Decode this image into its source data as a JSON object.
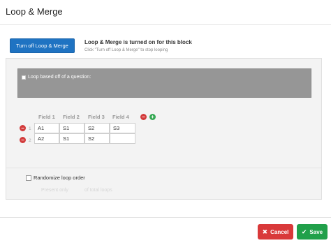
{
  "header": {
    "title": "Loop & Merge"
  },
  "loop": {
    "button_label": "Turn off Loop & Merge",
    "status_title": "Loop & Merge is turned on for this block",
    "status_subtitle": "Click \"Turn off Loop & Merge\" to stop looping",
    "question_checkbox_label": "Loop based off of a question:"
  },
  "table": {
    "headers": [
      "Field 1",
      "Field 2",
      "Field 3",
      "Field 4"
    ],
    "rows": [
      {
        "num": "1",
        "cells": [
          "A1",
          "S1",
          "S2",
          "S3"
        ]
      },
      {
        "num": "2",
        "cells": [
          "A2",
          "S1",
          "S2",
          ""
        ]
      }
    ]
  },
  "options": {
    "randomize_label": "Randomize loop order",
    "present_only": "Present only",
    "of_total_loops": "of total loops"
  },
  "footer": {
    "cancel_label": "Cancel",
    "save_label": "Save"
  },
  "colors": {
    "primary": "#1f73c2",
    "cancel": "#d9393a",
    "save": "#21a04a",
    "remove": "#d23a3a",
    "add": "#34a853"
  },
  "icons": {
    "remove": "minus-circle-icon",
    "add": "plus-circle-icon",
    "cancel": "x-icon",
    "save": "check-icon"
  }
}
